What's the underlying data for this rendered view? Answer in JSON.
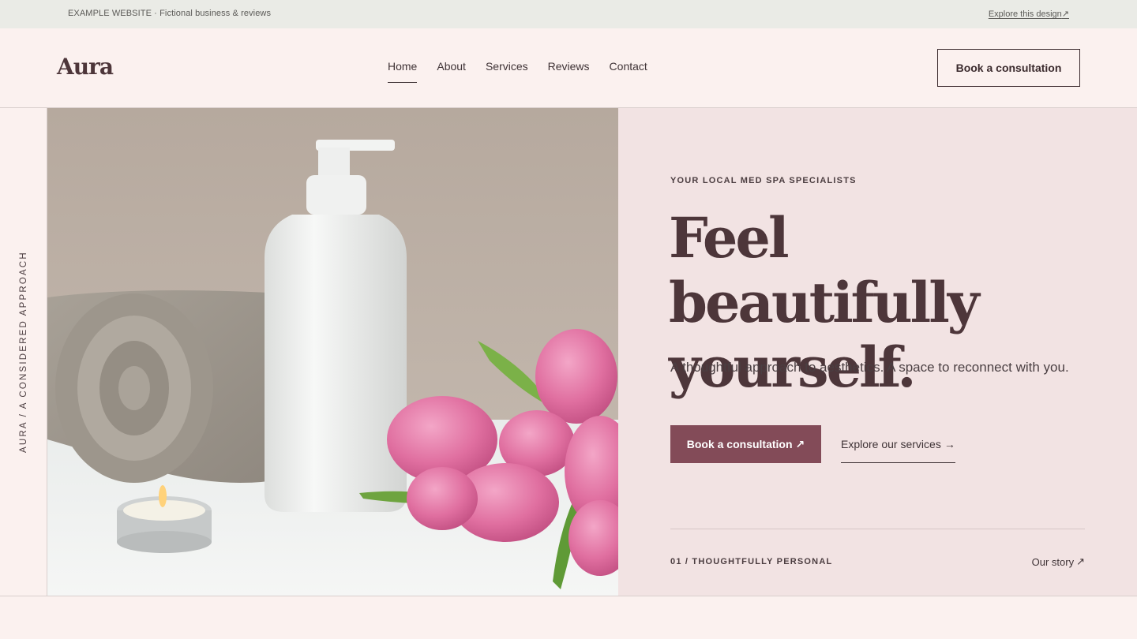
{
  "topbar": {
    "left_text": "EXAMPLE WEBSITE · Fictional business & reviews",
    "right_link": "Explore this design",
    "right_icon": "arrow-up-right-icon"
  },
  "header": {
    "logo": "Aura",
    "nav": [
      {
        "label": "Home",
        "active": true
      },
      {
        "label": "About",
        "active": false
      },
      {
        "label": "Services",
        "active": false
      },
      {
        "label": "Reviews",
        "active": false
      },
      {
        "label": "Contact",
        "active": false
      }
    ],
    "cta_label": "Book a consultation"
  },
  "rail": {
    "text": "AURA / A CONSIDERED APPROACH"
  },
  "hero": {
    "eyebrow": "YOUR LOCAL MED SPA SPECIALISTS",
    "headline_line1": "Feel beautifully",
    "headline_line2": "yourself.",
    "subtext": "A thoughtful approach to aesthetics. A space to reconnect with you.",
    "primary_cta": "Book a consultation",
    "primary_cta_icon": "arrow-up-right-icon",
    "secondary_cta": "Explore our services",
    "secondary_cta_icon": "arrow-right-icon",
    "feature_label": "01 / THOUGHTFULLY PERSONAL",
    "story_link": "Our story",
    "story_icon": "arrow-up-right-icon"
  },
  "colors": {
    "brand": "#4d363a",
    "accent": "#834b58",
    "page_bg": "#fbf1ef",
    "panel_bg": "#f2e3e3",
    "topbar_bg": "#eaebe6"
  }
}
